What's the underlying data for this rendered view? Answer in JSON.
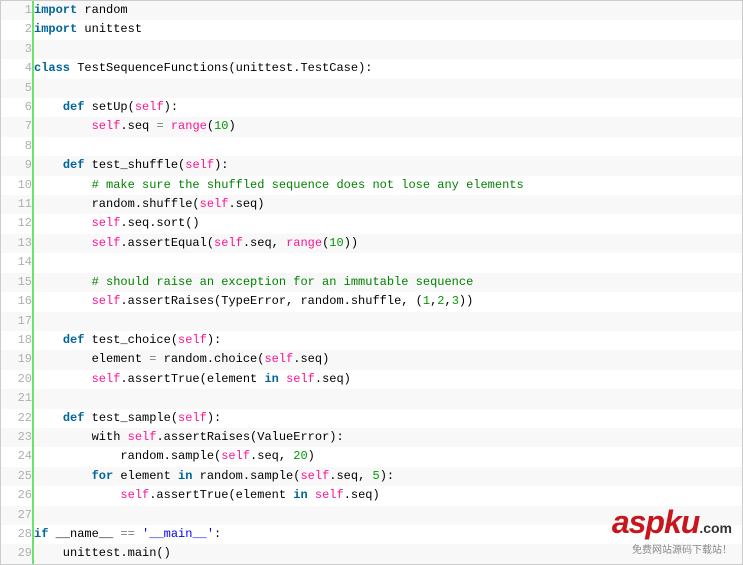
{
  "lines": [
    {
      "n": 1,
      "tokens": [
        [
          "kw",
          "import"
        ],
        [
          "plain",
          " random"
        ]
      ]
    },
    {
      "n": 2,
      "tokens": [
        [
          "kw",
          "import"
        ],
        [
          "plain",
          " unittest"
        ]
      ]
    },
    {
      "n": 3,
      "tokens": [
        [
          "plain",
          " "
        ]
      ]
    },
    {
      "n": 4,
      "tokens": [
        [
          "kw",
          "class"
        ],
        [
          "plain",
          " TestSequenceFunctions(unittest.TestCase):"
        ]
      ]
    },
    {
      "n": 5,
      "tokens": [
        [
          "plain",
          " "
        ]
      ]
    },
    {
      "n": 6,
      "tokens": [
        [
          "plain",
          "    "
        ],
        [
          "kw",
          "def"
        ],
        [
          "plain",
          " setUp("
        ],
        [
          "func",
          "self"
        ],
        [
          "plain",
          "):"
        ]
      ]
    },
    {
      "n": 7,
      "tokens": [
        [
          "plain",
          "        "
        ],
        [
          "func",
          "self"
        ],
        [
          "plain",
          ".seq "
        ],
        [
          "op",
          "="
        ],
        [
          "plain",
          " "
        ],
        [
          "func",
          "range"
        ],
        [
          "plain",
          "("
        ],
        [
          "num",
          "10"
        ],
        [
          "plain",
          ")"
        ]
      ]
    },
    {
      "n": 8,
      "tokens": [
        [
          "plain",
          " "
        ]
      ]
    },
    {
      "n": 9,
      "tokens": [
        [
          "plain",
          "    "
        ],
        [
          "kw",
          "def"
        ],
        [
          "plain",
          " test_shuffle("
        ],
        [
          "func",
          "self"
        ],
        [
          "plain",
          "):"
        ]
      ]
    },
    {
      "n": 10,
      "tokens": [
        [
          "plain",
          "        "
        ],
        [
          "com",
          "# make sure the shuffled sequence does not lose any elements"
        ]
      ]
    },
    {
      "n": 11,
      "tokens": [
        [
          "plain",
          "        random.shuffle("
        ],
        [
          "func",
          "self"
        ],
        [
          "plain",
          ".seq)"
        ]
      ]
    },
    {
      "n": 12,
      "tokens": [
        [
          "plain",
          "        "
        ],
        [
          "func",
          "self"
        ],
        [
          "plain",
          ".seq.sort()"
        ]
      ]
    },
    {
      "n": 13,
      "tokens": [
        [
          "plain",
          "        "
        ],
        [
          "func",
          "self"
        ],
        [
          "plain",
          ".assertEqual("
        ],
        [
          "func",
          "self"
        ],
        [
          "plain",
          ".seq, "
        ],
        [
          "func",
          "range"
        ],
        [
          "plain",
          "("
        ],
        [
          "num",
          "10"
        ],
        [
          "plain",
          "))"
        ]
      ]
    },
    {
      "n": 14,
      "tokens": [
        [
          "plain",
          " "
        ]
      ]
    },
    {
      "n": 15,
      "tokens": [
        [
          "plain",
          "        "
        ],
        [
          "com",
          "# should raise an exception for an immutable sequence"
        ]
      ]
    },
    {
      "n": 16,
      "tokens": [
        [
          "plain",
          "        "
        ],
        [
          "func",
          "self"
        ],
        [
          "plain",
          ".assertRaises(TypeError, random.shuffle, ("
        ],
        [
          "num",
          "1"
        ],
        [
          "plain",
          ","
        ],
        [
          "num",
          "2"
        ],
        [
          "plain",
          ","
        ],
        [
          "num",
          "3"
        ],
        [
          "plain",
          "))"
        ]
      ]
    },
    {
      "n": 17,
      "tokens": [
        [
          "plain",
          " "
        ]
      ]
    },
    {
      "n": 18,
      "tokens": [
        [
          "plain",
          "    "
        ],
        [
          "kw",
          "def"
        ],
        [
          "plain",
          " test_choice("
        ],
        [
          "func",
          "self"
        ],
        [
          "plain",
          "):"
        ]
      ]
    },
    {
      "n": 19,
      "tokens": [
        [
          "plain",
          "        element "
        ],
        [
          "op",
          "="
        ],
        [
          "plain",
          " random.choice("
        ],
        [
          "func",
          "self"
        ],
        [
          "plain",
          ".seq)"
        ]
      ]
    },
    {
      "n": 20,
      "tokens": [
        [
          "plain",
          "        "
        ],
        [
          "func",
          "self"
        ],
        [
          "plain",
          ".assertTrue(element "
        ],
        [
          "kw",
          "in"
        ],
        [
          "plain",
          " "
        ],
        [
          "func",
          "self"
        ],
        [
          "plain",
          ".seq)"
        ]
      ]
    },
    {
      "n": 21,
      "tokens": [
        [
          "plain",
          " "
        ]
      ]
    },
    {
      "n": 22,
      "tokens": [
        [
          "plain",
          "    "
        ],
        [
          "kw",
          "def"
        ],
        [
          "plain",
          " test_sample("
        ],
        [
          "func",
          "self"
        ],
        [
          "plain",
          "):"
        ]
      ]
    },
    {
      "n": 23,
      "tokens": [
        [
          "plain",
          "        with "
        ],
        [
          "func",
          "self"
        ],
        [
          "plain",
          ".assertRaises(ValueError):"
        ]
      ]
    },
    {
      "n": 24,
      "tokens": [
        [
          "plain",
          "            random.sample("
        ],
        [
          "func",
          "self"
        ],
        [
          "plain",
          ".seq, "
        ],
        [
          "num",
          "20"
        ],
        [
          "plain",
          ")"
        ]
      ]
    },
    {
      "n": 25,
      "tokens": [
        [
          "plain",
          "        "
        ],
        [
          "kw",
          "for"
        ],
        [
          "plain",
          " element "
        ],
        [
          "kw",
          "in"
        ],
        [
          "plain",
          " random.sample("
        ],
        [
          "func",
          "self"
        ],
        [
          "plain",
          ".seq, "
        ],
        [
          "num",
          "5"
        ],
        [
          "plain",
          "):"
        ]
      ]
    },
    {
      "n": 26,
      "tokens": [
        [
          "plain",
          "            "
        ],
        [
          "func",
          "self"
        ],
        [
          "plain",
          ".assertTrue(element "
        ],
        [
          "kw",
          "in"
        ],
        [
          "plain",
          " "
        ],
        [
          "func",
          "self"
        ],
        [
          "plain",
          ".seq)"
        ]
      ]
    },
    {
      "n": 27,
      "tokens": [
        [
          "plain",
          " "
        ]
      ]
    },
    {
      "n": 28,
      "tokens": [
        [
          "kw",
          "if"
        ],
        [
          "plain",
          " __name__ "
        ],
        [
          "op",
          "="
        ],
        [
          "op",
          "="
        ],
        [
          "plain",
          " "
        ],
        [
          "str",
          "'__main__'"
        ],
        [
          "plain",
          ":"
        ]
      ]
    },
    {
      "n": 29,
      "tokens": [
        [
          "plain",
          "    unittest.main()"
        ]
      ]
    }
  ],
  "watermark": {
    "main": "aspku",
    "dotcom": ".com",
    "sub": "免费网站源码下载站！"
  }
}
